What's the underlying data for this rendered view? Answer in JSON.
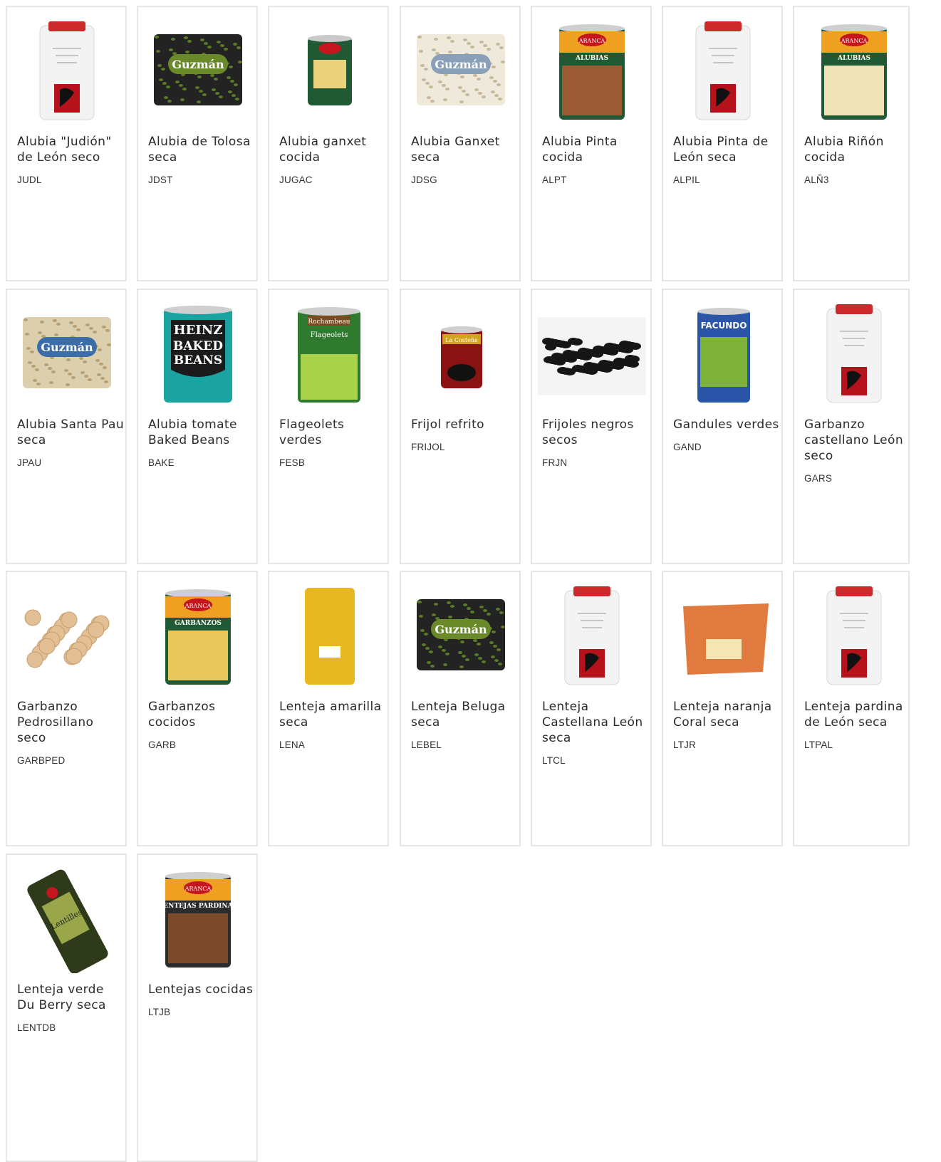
{
  "products": [
    {
      "name": "Alubia \"Judión\" de León seco",
      "code": "JUDL",
      "image": "white-sack-leon-logo"
    },
    {
      "name": "Alubia de Tolosa seca",
      "code": "JDST",
      "image": "black-bag-guzman"
    },
    {
      "name": "Alubia ganxet cocida",
      "code": "JUGAC",
      "image": "green-can-aranca"
    },
    {
      "name": "Alubia Ganxet seca",
      "code": "JDSG",
      "image": "white-beans-bag-guzman"
    },
    {
      "name": "Alubia Pinta cocida",
      "code": "ALPT",
      "image": "can-aranca-pinta"
    },
    {
      "name": "Alubia Pinta de León seca",
      "code": "ALPIL",
      "image": "white-sack-leon-logo"
    },
    {
      "name": "Alubia Riñón cocida",
      "code": "ALÑ3",
      "image": "can-aranca-rinon"
    },
    {
      "name": "Alubia Santa Pau seca",
      "code": "JPAU",
      "image": "beige-bag-guzman"
    },
    {
      "name": "Alubia tomate Baked Beans",
      "code": "BAKE",
      "image": "can-heinz-baked-beans"
    },
    {
      "name": "Flageolets verdes",
      "code": "FESB",
      "image": "can-rochambeau-flageolets"
    },
    {
      "name": "Frijol refrito",
      "code": "FRIJOL",
      "image": "can-la-costena"
    },
    {
      "name": "Frijoles negros secos",
      "code": "FRJN",
      "image": "black-beans-pile"
    },
    {
      "name": "Gandules verdes",
      "code": "GAND",
      "image": "can-facundo"
    },
    {
      "name": "Garbanzo castellano León seco",
      "code": "GARS",
      "image": "white-sack-leon-logo"
    },
    {
      "name": "Garbanzo Pedrosillano seco",
      "code": "GARBPED",
      "image": "chickpeas-pile"
    },
    {
      "name": "Garbanzos cocidos",
      "code": "GARB",
      "image": "can-aranca-garbanzos"
    },
    {
      "name": "Lenteja amarilla seca",
      "code": "LENA",
      "image": "yellow-lentil-bag"
    },
    {
      "name": "Lenteja Beluga seca",
      "code": "LEBEL",
      "image": "black-bag-guzman"
    },
    {
      "name": "Lenteja Castellana León seca",
      "code": "LTCL",
      "image": "white-sack-leon-logo"
    },
    {
      "name": "Lenteja naranja Coral seca",
      "code": "LTJR",
      "image": "orange-lentil-bag"
    },
    {
      "name": "Lenteja pardina de León seca",
      "code": "LTPAL",
      "image": "white-sack-leon-logo"
    },
    {
      "name": "Lenteja verde Du Berry seca",
      "code": "LENTDB",
      "image": "green-lentil-bag"
    },
    {
      "name": "Lentejas cocidas",
      "code": "LTJB",
      "image": "can-aranca-lentejas"
    }
  ],
  "image_labels": {
    "guzman": "Guzmán",
    "aranca": "ARANCA",
    "heinz": "HEINZ",
    "baked": "BAKED",
    "beans": "BEANS",
    "rochambeau": "Rochambeau",
    "flageolets": "Flageolets",
    "costena": "La Costeña",
    "facundo": "FACUNDO",
    "alubias": "ALUBIAS",
    "garbanzos": "GARBANZOS",
    "lentejas": "LENTEJAS PARDINAS",
    "lentilles": "Lentilles"
  },
  "colors": {
    "card_border": "#e6e6e6",
    "title_text": "#2b2b2b",
    "code_text": "#333333"
  }
}
